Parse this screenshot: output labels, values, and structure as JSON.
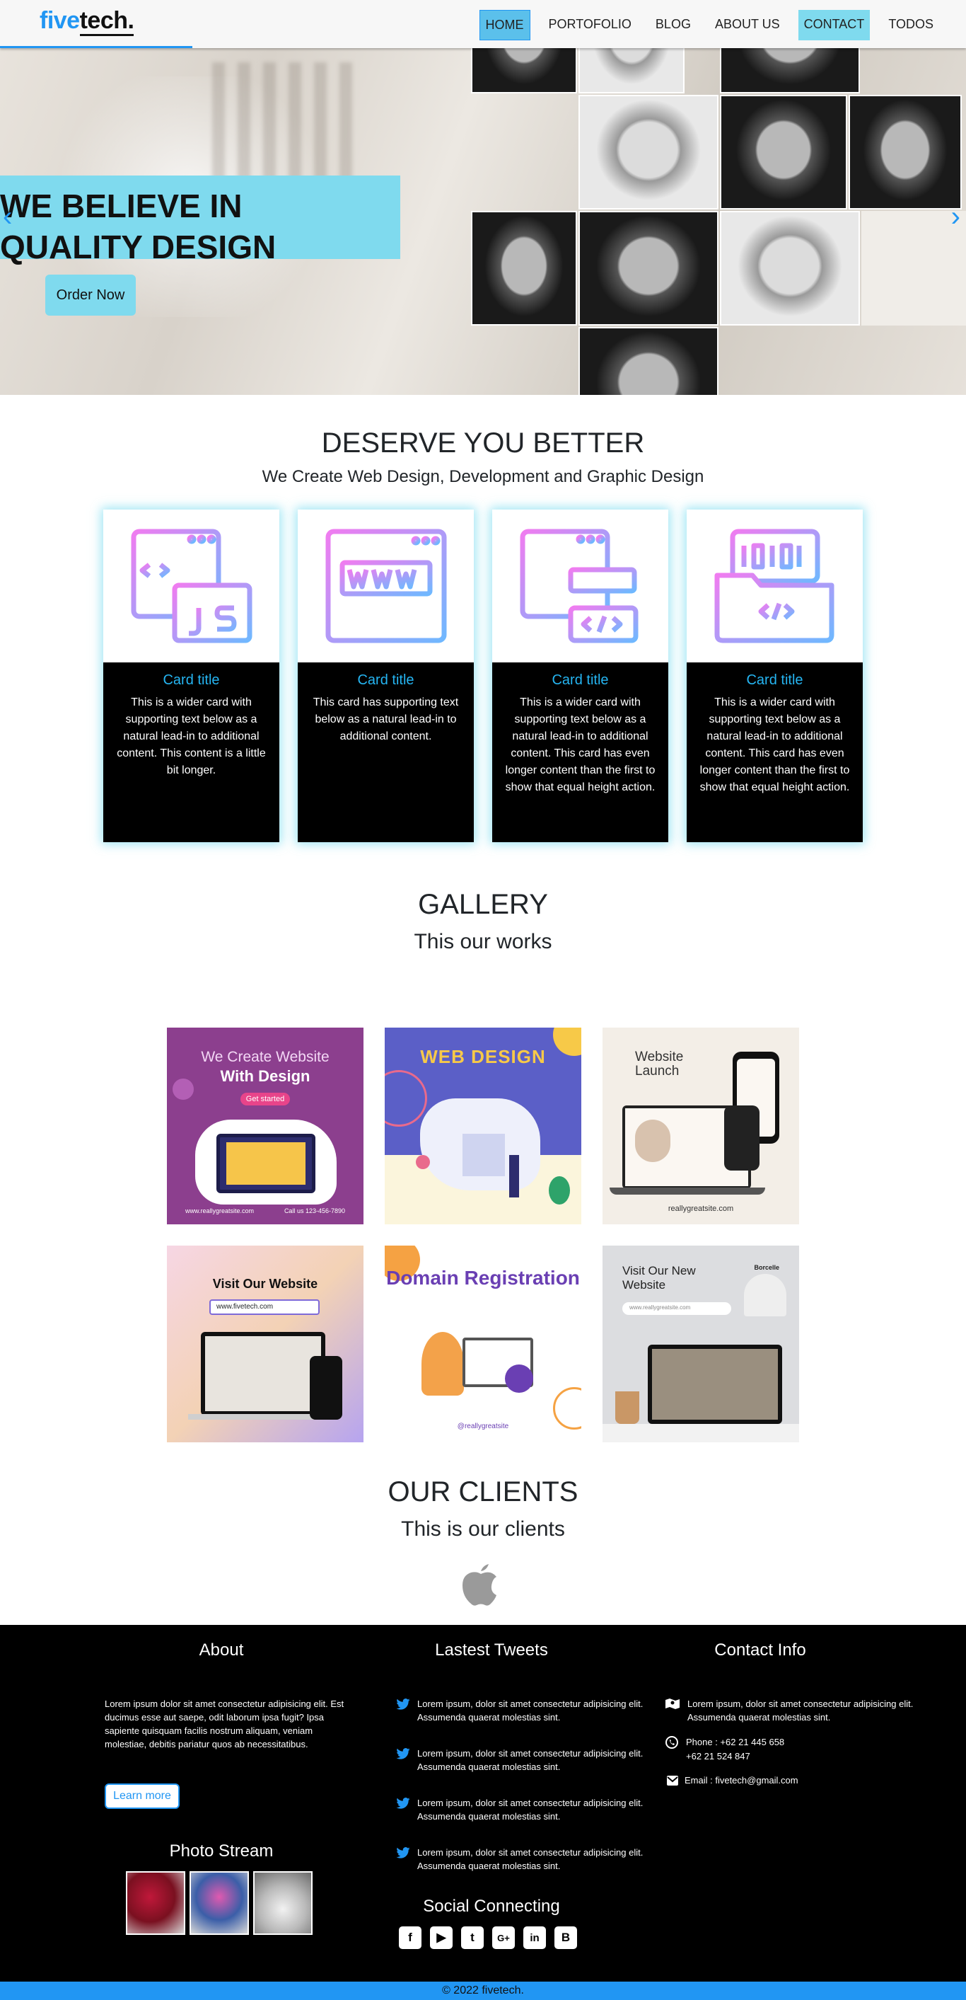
{
  "nav": {
    "logo_five": "five",
    "logo_tech": "tech.",
    "items": [
      "HOME",
      "PORTOFOLIO",
      "BLOG",
      "ABOUT US",
      "CONTACT",
      "TODOS"
    ]
  },
  "hero": {
    "title": "WE BELIEVE IN\nQUALITY DESIGN",
    "order_button": "Order Now",
    "prev_arrow": "‹",
    "next_arrow": "›"
  },
  "services": {
    "heading": "DESERVE YOU BETTER",
    "subheading": "We Create Web Design, Development and Graphic Design",
    "cards": [
      {
        "icon": "code-js-icon",
        "title": "Card title",
        "text": "This is a wider card with supporting text below as a natural lead-in to additional content. This content is a little bit longer."
      },
      {
        "icon": "www-browser-icon",
        "title": "Card title",
        "text": "This card has supporting text below as a natural lead-in to additional content."
      },
      {
        "icon": "sitemap-code-icon",
        "title": "Card title",
        "text": "This is a wider card with supporting text below as a natural lead-in to additional content. This card has even longer content than the first to show that equal height action."
      },
      {
        "icon": "binary-folder-icon",
        "title": "Card title",
        "text": "This is a wider card with supporting text below as a natural lead-in to additional content. This card has even longer content than the first to show that equal height action."
      }
    ],
    "accent": "#25b5f2"
  },
  "gallery": {
    "heading": "GALLERY",
    "subheading": "This our works",
    "items": [
      {
        "line1": "We Create Website",
        "line2": "With Design",
        "button": "Get started",
        "footer_left": "www.reallygreatsite.com",
        "footer_right": "Call us 123-456-7890"
      },
      {
        "title": "WEB DESIGN"
      },
      {
        "title": "Website Launch",
        "footer": "reallygreatsite.com"
      },
      {
        "title": "Visit Our Website",
        "url": "www.fivetech.com"
      },
      {
        "title": "Domain Registration",
        "footer": "@reallygreatsite"
      },
      {
        "title": "Visit Our New Website",
        "brand": "Borcelle",
        "url": "www.reallygreatsite.com"
      }
    ]
  },
  "clients": {
    "heading": "OUR CLIENTS",
    "subheading": "This is our clients",
    "logos": [
      "apple-logo"
    ]
  },
  "footer": {
    "about_heading": "About",
    "about_text": "Lorem ipsum dolor sit amet consectetur adipisicing elit. Est ducimus esse aut saepe, odit laborum ipsa fugit? Ipsa sapiente quisquam facilis nostrum aliquam, veniam molestiae, debitis pariatur quos ab necessitatibus.",
    "learn_more": "Learn more",
    "photo_stream": "Photo Stream",
    "tweets_heading": "Lastest Tweets",
    "tweets": [
      "Lorem ipsum, dolor sit amet consectetur adipisicing elit. Assumenda quaerat molestias sint.",
      "Lorem ipsum, dolor sit amet consectetur adipisicing elit. Assumenda quaerat molestias sint.",
      "Lorem ipsum, dolor sit amet consectetur adipisicing elit. Assumenda quaerat molestias sint.",
      "Lorem ipsum, dolor sit amet consectetur adipisicing elit. Assumenda quaerat molestias sint."
    ],
    "social_heading": "Social Connecting",
    "social": [
      "facebook-icon",
      "youtube-icon",
      "twitter-icon",
      "google-plus-icon",
      "linkedin-icon",
      "blogger-icon"
    ],
    "contact_heading": "Contact Info",
    "contact_address": "Lorem ipsum, dolor sit amet consectetur adipisicing elit. Assumenda quaerat molestias sint.",
    "contact_phone_1": "Phone : +62 21 445 658",
    "contact_phone_2": "+62 21 524 847",
    "contact_email": "Email : fivetech@gmail.com"
  },
  "copyright": "© 2022 fivetech.",
  "colors": {
    "primary": "#2196f3",
    "cyan": "#7fdaee",
    "footer_bg": "#000000"
  }
}
